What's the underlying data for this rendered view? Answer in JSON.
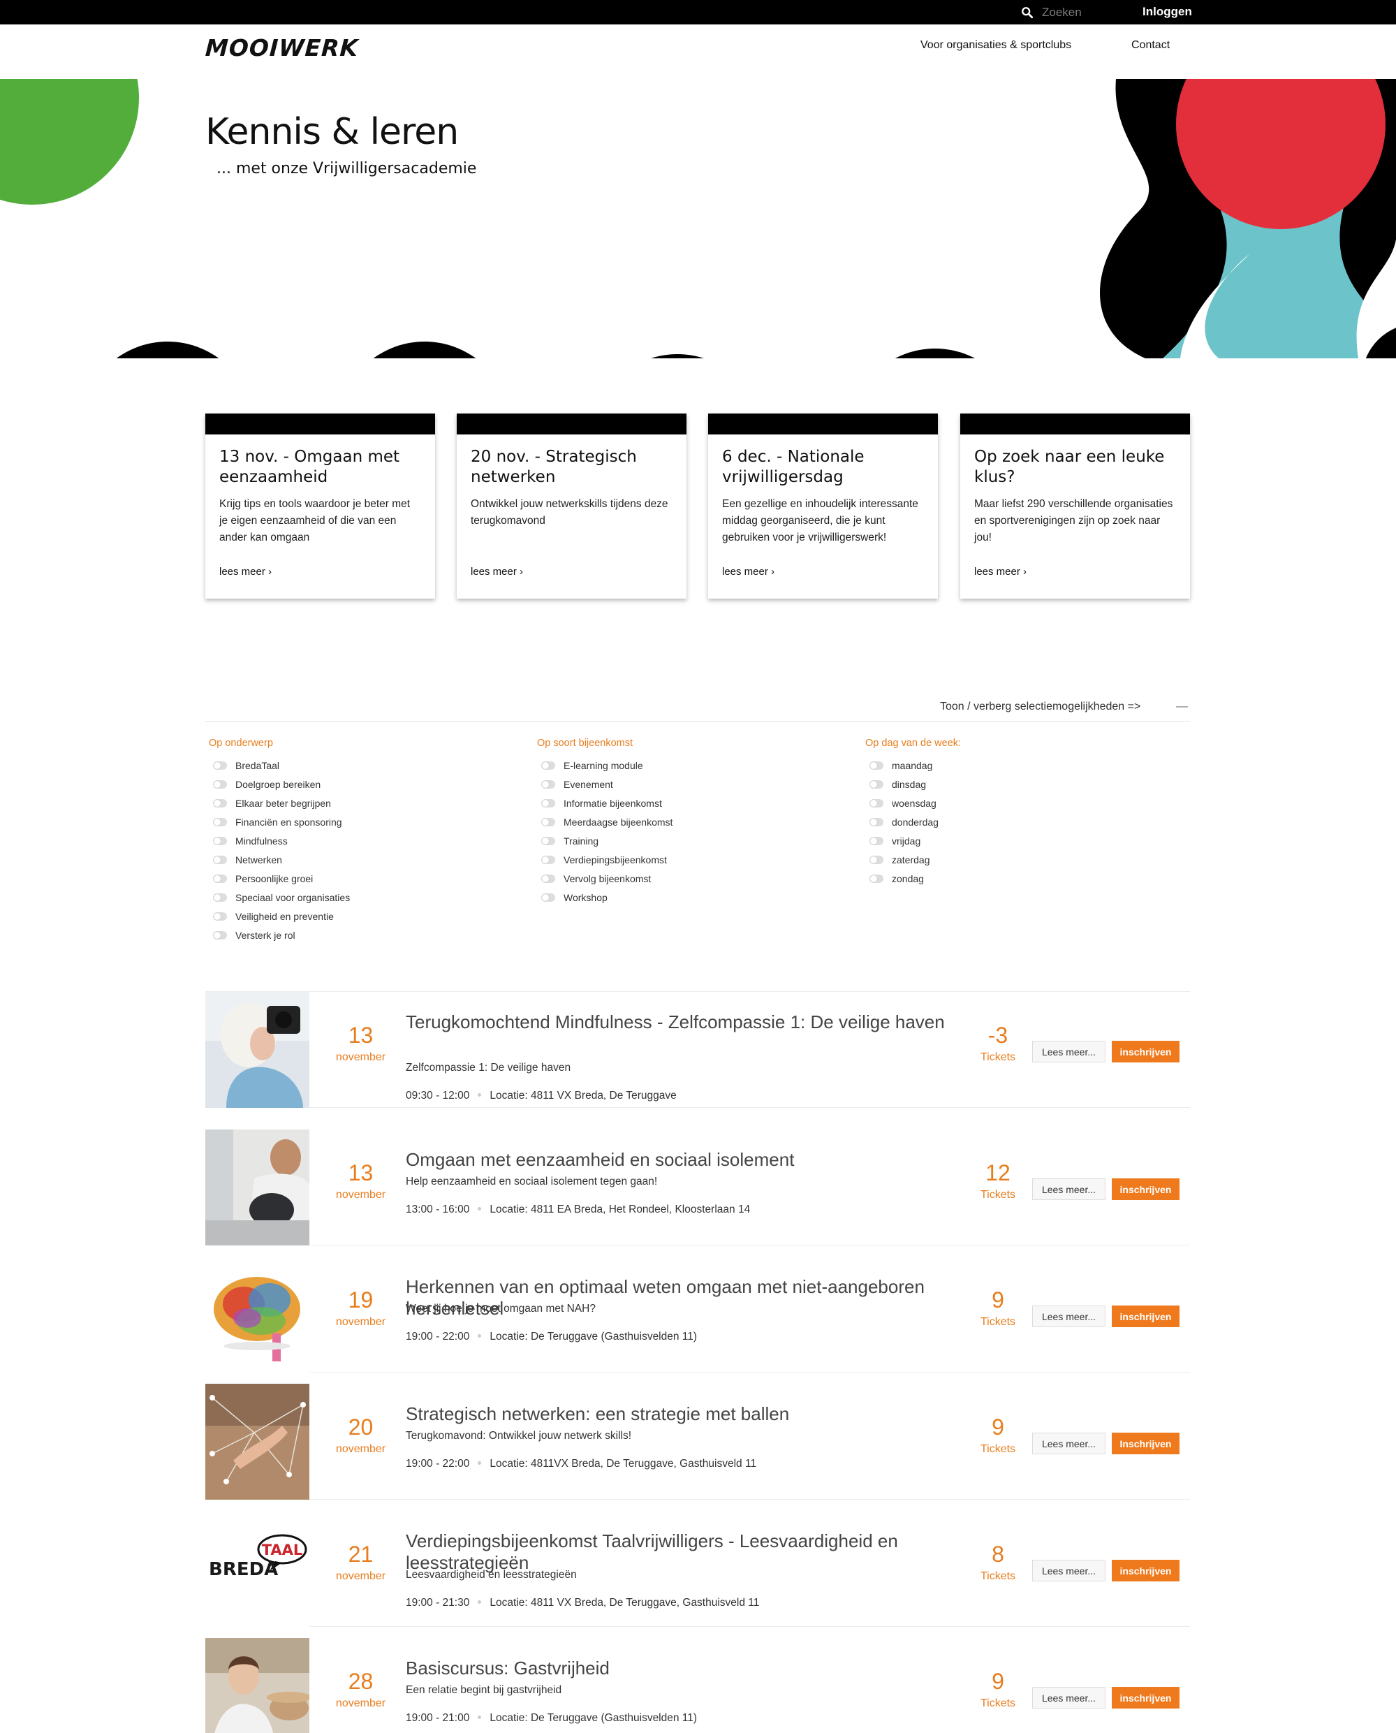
{
  "topbar": {
    "search_placeholder": "Zoeken",
    "login_label": "Inloggen"
  },
  "header": {
    "logo": "MOOIWERK",
    "nav": [
      "Voor organisaties & sportclubs",
      "Contact"
    ]
  },
  "hero": {
    "title": "Kennis & leren",
    "subtitle": "... met onze Vrijwilligersacademie"
  },
  "cards": [
    {
      "title": "13 nov. - Omgaan met eenzaamheid",
      "text": "Krijg tips en tools waardoor je beter met je eigen eenzaamheid of die van een ander kan omgaan",
      "link": "lees meer ›"
    },
    {
      "title": "20 nov. - Strategisch netwerken",
      "text": "Ontwikkel jouw netwerkskills tijdens deze terugkomavond",
      "link": "lees meer ›"
    },
    {
      "title": "6 dec. - Nationale vrijwilligersdag",
      "text": "Een gezellige en inhoudelijk interessante middag georganiseerd, die je kunt gebruiken voor je vrijwilligerswerk!",
      "link": "lees meer ›"
    },
    {
      "title": "Op zoek naar een leuke klus?",
      "text": "Maar liefst 290 verschillende organisaties en sportverenigingen zijn op zoek naar jou!",
      "link": "lees meer ›"
    }
  ],
  "filters": {
    "toggle_label": "Toon / verberg selectiemogelijkheden =>",
    "toggle_icon": "—",
    "groups": [
      {
        "heading": "Op onderwerp",
        "options": [
          "BredaTaal",
          "Doelgroep bereiken",
          "Elkaar beter begrijpen",
          "Financiën en sponsoring",
          "Mindfulness",
          "Netwerken",
          "Persoonlijke groei",
          "Speciaal voor organisaties",
          "Veiligheid en preventie",
          "Versterk je rol"
        ]
      },
      {
        "heading": "Op soort bijeenkomst",
        "options": [
          "E-learning module",
          "Evenement",
          "Informatie bijeenkomst",
          "Meerdaagse bijeenkomst",
          "Training",
          "Verdiepingsbijeenkomst",
          "Vervolg bijeenkomst",
          "Workshop"
        ]
      },
      {
        "heading": "Op dag van de week:",
        "options": [
          "maandag",
          "dinsdag",
          "woensdag",
          "donderdag",
          "vrijdag",
          "zaterdag",
          "zondag"
        ]
      }
    ]
  },
  "events": [
    {
      "day": "13",
      "month": "november",
      "title": "Terugkomochtend Mindfulness - Zelfcompassie 1: De veilige haven",
      "subtitle": "Zelfcompassie 1: De veilige haven",
      "time": "09:30 - 12:00",
      "location": "Locatie: 4811 VX Breda, De Teruggave",
      "tickets": "-3",
      "tickets_label": "Tickets",
      "more_label": "Lees meer...",
      "signup_label": "inschrijven"
    },
    {
      "day": "13",
      "month": "november",
      "title": "Omgaan met eenzaamheid en sociaal isolement",
      "subtitle": "Help eenzaamheid en sociaal isolement tegen gaan!",
      "time": "13:00 - 16:00",
      "location": "Locatie: 4811 EA Breda, Het Rondeel, Kloosterlaan 14",
      "tickets": "12",
      "tickets_label": "Tickets",
      "more_label": "Lees meer...",
      "signup_label": "inschrijven"
    },
    {
      "day": "19",
      "month": "november",
      "title": "Herkennen van en optimaal weten omgaan met niet-aangeboren hersenletsel",
      "subtitle": "Weet jij hoe je moet omgaan met NAH?",
      "time": "19:00 - 22:00",
      "location": "Locatie: De Teruggave (Gasthuisvelden 11)",
      "tickets": "9",
      "tickets_label": "Tickets",
      "more_label": "Lees meer...",
      "signup_label": "inschrijven"
    },
    {
      "day": "20",
      "month": "november",
      "title": "Strategisch netwerken: een strategie met ballen",
      "subtitle": "Terugkomavond: Ontwikkel jouw netwerk skills!",
      "time": "19:00 - 22:00",
      "location": "Locatie: 4811VX Breda, De Teruggave, Gasthuisveld 11",
      "tickets": "9",
      "tickets_label": "Tickets",
      "more_label": "Lees meer...",
      "signup_label": "Inschrijven"
    },
    {
      "day": "21",
      "month": "november",
      "title": "Verdiepingsbijeenkomst Taalvrijwilligers - Leesvaardigheid en leesstrategieën",
      "subtitle": "Leesvaardigheid en leesstrategieën",
      "time": "19:00 - 21:30",
      "location": "Locatie: 4811 VX Breda, De Teruggave, Gasthuisveld 11",
      "tickets": "8",
      "tickets_label": "Tickets",
      "more_label": "Lees meer...",
      "signup_label": "inschrijven",
      "logo_a": "BREDA",
      "logo_b": "TAAL"
    },
    {
      "day": "28",
      "month": "november",
      "title": "Basiscursus: Gastvrijheid",
      "subtitle": "Een relatie begint bij gastvrijheid",
      "time": "19:00 - 21:00",
      "location": "Locatie: De Teruggave (Gasthuisvelden 11)",
      "tickets": "9",
      "tickets_label": "Tickets",
      "more_label": "Lees meer...",
      "signup_label": "inschrijven"
    }
  ],
  "colors": {
    "accent": "#ef7a1e",
    "green": "#52ad3a",
    "red": "#e32f3b",
    "teal": "#6cc3c9",
    "yellow": "#fbd51a",
    "purple": "#b5519b"
  }
}
